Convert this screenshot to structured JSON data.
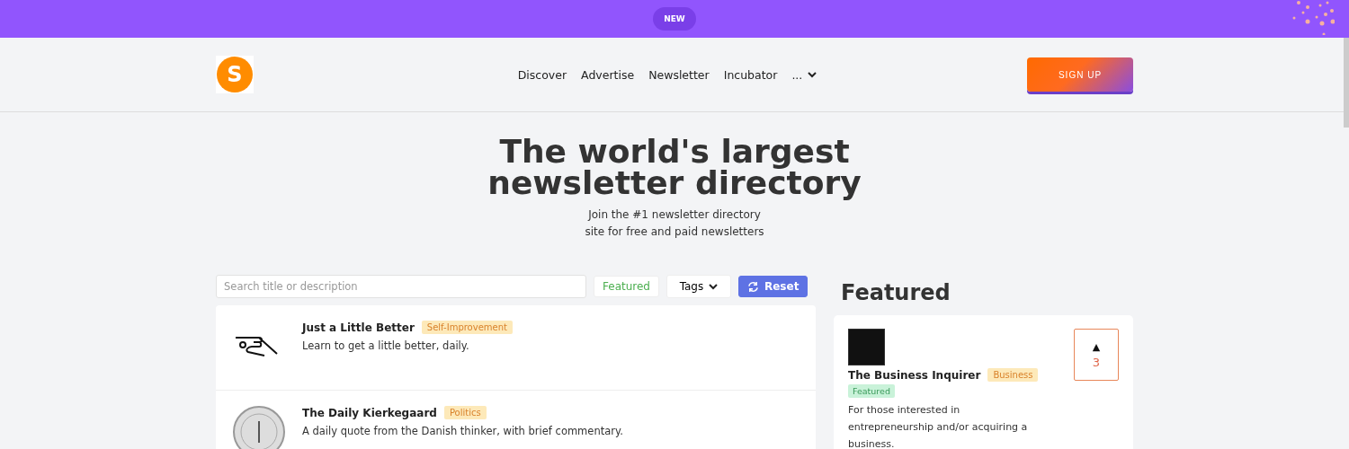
{
  "banner": {
    "badge": "NEW"
  },
  "nav": {
    "logo": "S",
    "links": [
      {
        "label": "Discover"
      },
      {
        "label": "Advertise"
      },
      {
        "label": "Newsletter"
      },
      {
        "label": "Incubator"
      },
      {
        "label": "..."
      }
    ],
    "signup": "SIGN UP"
  },
  "hero": {
    "title": "The world's largest newsletter directory",
    "subtitle": "Join the #1 newsletter directory site for free and paid newsletters"
  },
  "filters": {
    "search_placeholder": "Search title or description",
    "featured": "Featured",
    "tags": "Tags",
    "reset": "Reset"
  },
  "listings": [
    {
      "title": "Just a Little Better",
      "tag": "Self-Improvement",
      "description": "Learn to get a little better, daily.",
      "kind": "drawing"
    },
    {
      "title": "The Daily Kierkegaard",
      "tag": "Politics",
      "description": "A daily quote from the Danish thinker, with brief commentary.",
      "kind": "seal"
    }
  ],
  "featured": {
    "heading": "Featured",
    "items": [
      {
        "title": "The Business Inquirer",
        "tag": "Business",
        "badge": "Featured",
        "description": "For those interested in entrepreneurship and/or acquiring a business.",
        "arrow": "▲",
        "votes": "3"
      }
    ]
  }
}
